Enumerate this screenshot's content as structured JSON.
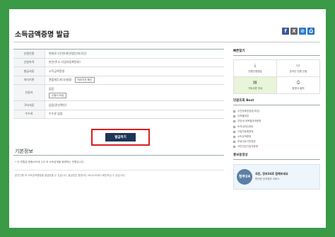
{
  "page_title": "소득금액증명 발급",
  "share": {
    "facebook": "f",
    "x": "X",
    "link": "⊘",
    "print": "⎙"
  },
  "form": [
    {
      "label": "신청인명",
      "value": "현재로그인한(개인/법인/외국인)"
    },
    {
      "label": "신청자격",
      "value": "본인(주소 사업자등록번호)"
    },
    {
      "label": "발급서류",
      "value": "소득금액증명"
    },
    {
      "label": "처리기관",
      "value": "관할세무서(국세청)",
      "button": "처리기관 확인"
    },
    {
      "label": "신청서",
      "value": "없음",
      "button": "신청서 작성"
    },
    {
      "label": "구비서류",
      "value": "없음(전산확인)"
    },
    {
      "label": "수수료",
      "value": "수수료 없음"
    }
  ],
  "apply_button": "발급하기",
  "basic": {
    "title": "기본정보",
    "bullet": "• 이 민원은 종합소득세 신고 후 소득금액을 증명하는 민원입니다.",
    "note": "본인인증 후 소득금액증명을 발급받을 수 있습니다. 발급받은 증명서는 MyGOV에서 확인하실 수 있습니다."
  },
  "side": {
    "quick_title": "빠른찾기",
    "quick": [
      {
        "icon": "download-icon",
        "glyph": "⤓",
        "label": "민원신청방법",
        "active": false
      },
      {
        "icon": "monitor-icon",
        "glyph": "▭",
        "label": "온라인 민원 신청",
        "active": false
      },
      {
        "icon": "document-icon",
        "glyph": "▤",
        "label": "구비서류 안내",
        "active": true
      },
      {
        "icon": "print-icon",
        "glyph": "⎙",
        "label": "증명서 출력",
        "active": false
      }
    ],
    "best_title": "민원조회 Best",
    "best": [
      "주민등록표등본(초본)",
      "건축물대장",
      "지방세 세목별과세증명",
      "토지(임야)대장",
      "사업자등록증명",
      "소득금액증명",
      "부동산등기부등본",
      "국민연금가입자증명"
    ],
    "promo_title": "홍보동영상",
    "promo_logo": "정부24",
    "promo_t1": "국민, 정부24로 접해보세요",
    "promo_t2": "편리한 전자정부 서비스"
  }
}
